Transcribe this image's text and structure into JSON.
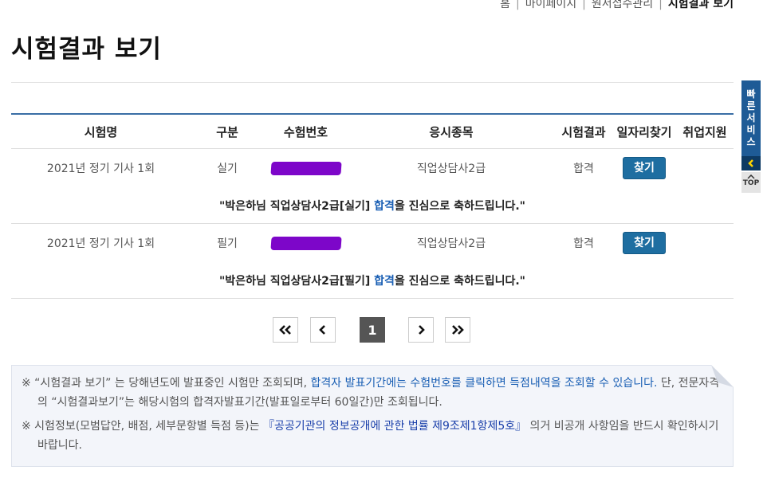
{
  "breadcrumb": {
    "items": [
      "홈",
      "마이페이지",
      "원서접수관리"
    ],
    "current": "시험결과 보기"
  },
  "page_title": "시험결과 보기",
  "table": {
    "headers": [
      "시험명",
      "구분",
      "수험번호",
      "응시종목",
      "시험결과",
      "일자리찾기",
      "취업지원"
    ],
    "rows": [
      {
        "exam_name": "2021년 정기 기사 1회",
        "category": "실기",
        "subject": "직업상담사2급",
        "result": "합격",
        "find_label": "찾기",
        "msg_prefix": "\"박은하님 직업상담사2급[실기] ",
        "msg_pass": "합격",
        "msg_suffix": "을 진심으로 축하드립니다.\""
      },
      {
        "exam_name": "2021년 정기 기사 1회",
        "category": "필기",
        "subject": "직업상담사2급",
        "result": "합격",
        "find_label": "찾기",
        "msg_prefix": "\"박은하님 직업상담사2급[필기] ",
        "msg_pass": "합격",
        "msg_suffix": "을 진심으로 축하드립니다.\""
      }
    ]
  },
  "pagination": {
    "current_page": "1"
  },
  "notice": {
    "line1_a": "※ “시험결과 보기” 는 당해년도에 발표중인 시험만 조회되며, ",
    "line1_b": "합격자 발표기간에는 수험번호를 클릭하면 득점내역을 조회할 수 있습니다.",
    "line1_c": " 단, 전문자격의 “시험결과보기”는 해당시험의 합격자발표기간(발표일로부터 60일간)만 조회됩니다.",
    "line2_a": "※ 시험정보(모범답안, 배점, 세부문항별 득점 등)는 ",
    "line2_b": "『공공기관의 정보공개에 관한 법률 제9조제1항제5호』",
    "line2_c": " 의거 비공개 사항임을 반드시 확인하시기 바랍니다."
  },
  "quick_service": {
    "label_chars": [
      "빠",
      "른",
      "서",
      "비",
      "스"
    ],
    "top_label": "TOP"
  },
  "colors": {
    "accent": "#1e6ea1",
    "table_top_border": "#3a6ea5",
    "pass_text": "#1a5fb4",
    "mask": "#7d06c9",
    "quick_service_bg": "#1e5b96"
  }
}
